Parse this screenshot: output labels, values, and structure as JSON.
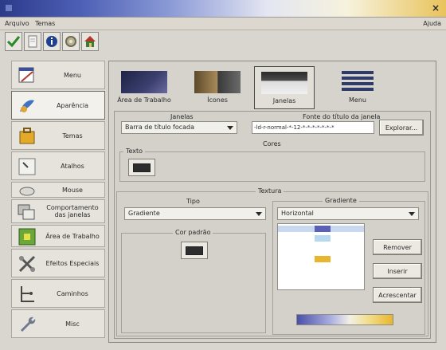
{
  "window": {
    "title": ""
  },
  "menubar": {
    "arquivo": "Arquivo",
    "temas": "Temas",
    "ajuda": "Ajuda"
  },
  "toolbar": {
    "items": [
      {
        "icon": "check-icon"
      },
      {
        "icon": "document-icon"
      },
      {
        "icon": "info-icon"
      },
      {
        "icon": "gear-icon"
      },
      {
        "icon": "house-icon"
      }
    ]
  },
  "sidebar": {
    "items": [
      {
        "label": "Menu",
        "icon": "menu-icon"
      },
      {
        "label": "Aparência",
        "icon": "appearance-icon"
      },
      {
        "label": "Temas",
        "icon": "themes-icon"
      },
      {
        "label": "Atalhos",
        "icon": "shortcuts-icon"
      },
      {
        "label": "Mouse",
        "icon": "mouse-icon"
      },
      {
        "label": "Comportamento das janelas",
        "icon": "window-behavior-icon"
      },
      {
        "label": "Área de Trabalho",
        "icon": "desktop-icon"
      },
      {
        "label": "Efeitos Especiais",
        "icon": "effects-icon"
      },
      {
        "label": "Caminhos",
        "icon": "paths-icon"
      },
      {
        "label": "Misc",
        "icon": "misc-icon"
      }
    ]
  },
  "tabs": [
    {
      "label": "Área de Trabalho"
    },
    {
      "label": "Ícones"
    },
    {
      "label": "Janelas"
    },
    {
      "label": "Menu"
    }
  ],
  "janelas": {
    "label": "Janelas",
    "value": "Barra de título focada"
  },
  "fonte": {
    "label": "Fonte do título da janela",
    "value": "-ld-r-normal-*-12-*-*-*-*-*-*-*",
    "button": "Explorar..."
  },
  "cores": {
    "label": "Cores",
    "texto_label": "Texto",
    "texto_color": "#2d2d2d"
  },
  "textura": {
    "label": "Textura",
    "tipo_label": "Tipo",
    "tipo_value": "Gradiente",
    "gradiente_label": "Gradiente",
    "gradiente_value": "Horizontal",
    "cor_padrao_label": "Cor padrão",
    "cor_padrao_color": "#2e2e2e",
    "buttons": {
      "remover": "Remover",
      "inserir": "Inserir",
      "acrescentar": "Acrescentar"
    },
    "gradient_stops": [
      "#5a5fb8",
      "#b7d9ef",
      "#e8b62e"
    ]
  }
}
